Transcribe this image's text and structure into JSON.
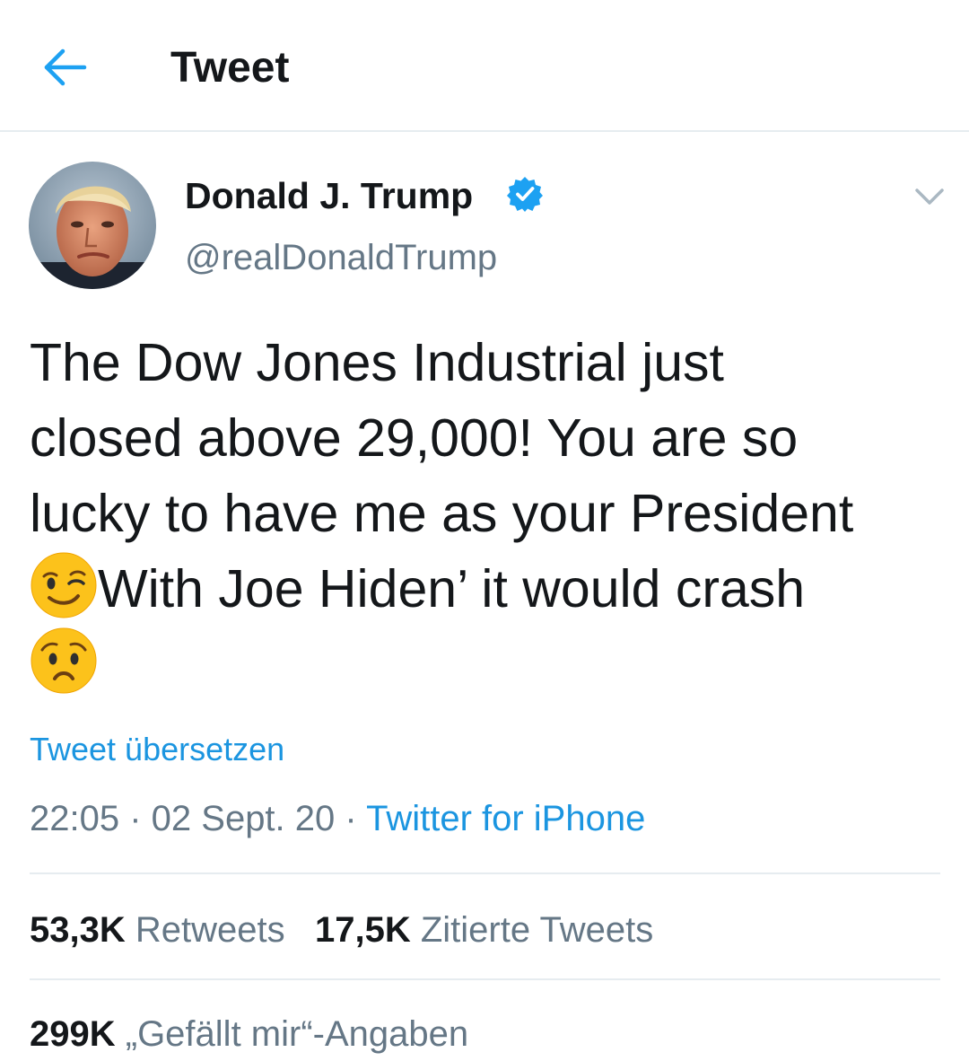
{
  "header": {
    "title": "Tweet",
    "back_icon": "arrow-left-icon"
  },
  "colors": {
    "accent": "#1da1f2",
    "link": "#1b95e0",
    "secondary_text": "#657786",
    "primary_text": "#14171a",
    "divider": "#e6ecf0"
  },
  "author": {
    "name": "Donald J. Trump",
    "handle": "@realDonaldTrump",
    "verified_icon": "verified-badge-icon",
    "menu_icon": "chevron-down-icon"
  },
  "tweet": {
    "line1": "The Dow Jones Industrial just",
    "line2": "closed above 29,000! You are so",
    "line3": "lucky to have me as your President",
    "line4": "With Joe Hiden’ it would crash",
    "emoji1": "winking-face-emoji",
    "emoji2": "worried-face-emoji"
  },
  "translate_label": "Tweet übersetzen",
  "meta": {
    "time": "22:05",
    "sep1": " · ",
    "date": "02 Sept. 20",
    "sep2": " · ",
    "source": "Twitter for iPhone"
  },
  "stats": {
    "retweets_count": "53,3K",
    "retweets_label": "Retweets",
    "quotes_count": "17,5K",
    "quotes_label": "Zitierte Tweets",
    "likes_count": "299K",
    "likes_label": "„Gefällt mir“-Angaben"
  }
}
